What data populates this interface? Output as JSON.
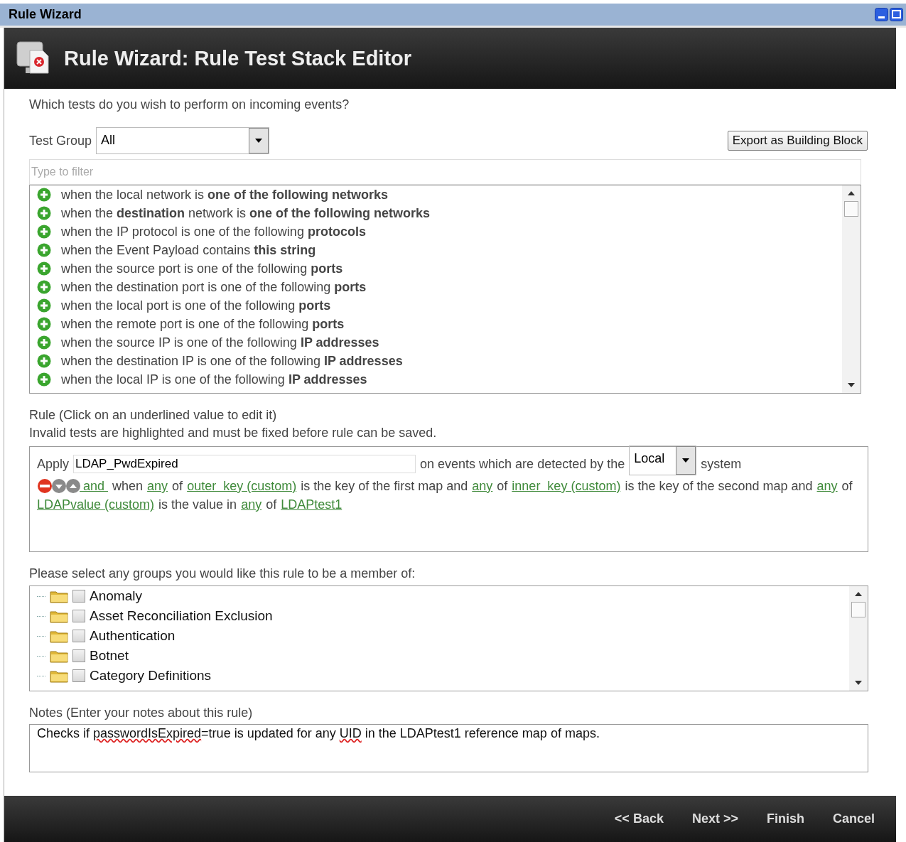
{
  "window": {
    "title": "Rule Wizard"
  },
  "header": {
    "title": "Rule Wizard: Rule Test Stack Editor"
  },
  "question": "Which tests do you wish to perform on incoming events?",
  "test_group": {
    "label": "Test Group",
    "value": "All"
  },
  "export_button": "Export as Building Block",
  "filter": {
    "placeholder": "Type to filter"
  },
  "tests": [
    "when the local network is **one of the following networks**",
    "when the **destination** network is **one of the following networks**",
    "when the IP protocol is one of the following **protocols**",
    "when the Event Payload contains **this string**",
    "when the source port is one of the following **ports**",
    "when the destination port is one of the following **ports**",
    "when the local port is one of the following **ports**",
    "when the remote port is one of the following **ports**",
    "when the source IP is one of the following **IP addresses**",
    "when the destination IP is one of the following **IP addresses**",
    "when the local IP is one of the following **IP addresses**"
  ],
  "rule_label": [
    "Rule (Click on an underlined value to edit it)",
    "Invalid tests are highlighted and must be fixed before rule can be saved."
  ],
  "rule": {
    "apply": "Apply",
    "name": "LDAP_PwdExpired",
    "events_text": "on events which are detected by the",
    "system_value": "Local",
    "system_text": "system",
    "parts": [
      {
        "kind": "link",
        "text": " and "
      },
      {
        "kind": "text",
        "text": "when"
      },
      {
        "kind": "link",
        "text": "any"
      },
      {
        "kind": "text",
        "text": "of"
      },
      {
        "kind": "link",
        "text": "outer  key (custom)"
      },
      {
        "kind": "text",
        "text": "is the key of the first map and"
      },
      {
        "kind": "link",
        "text": "any"
      },
      {
        "kind": "text",
        "text": "of"
      },
      {
        "kind": "link",
        "text": "inner  key (custom)"
      },
      {
        "kind": "text",
        "text": "is the key of the second map and"
      },
      {
        "kind": "link",
        "text": "any"
      },
      {
        "kind": "text",
        "text": "of"
      },
      {
        "kind": "link",
        "text": "LDAPvalue (custom)"
      },
      {
        "kind": "text",
        "text": "is the value in"
      },
      {
        "kind": "link",
        "text": "any"
      },
      {
        "kind": "text",
        "text": "of"
      },
      {
        "kind": "link",
        "text": "LDAPtest1"
      }
    ]
  },
  "groups_label": "Please select any groups you would like this rule to be a member of:",
  "groups": [
    {
      "label": "Anomaly",
      "checked": false
    },
    {
      "label": "Asset Reconciliation Exclusion",
      "checked": false
    },
    {
      "label": "Authentication",
      "checked": false
    },
    {
      "label": "Botnet",
      "checked": false
    },
    {
      "label": "Category Definitions",
      "checked": false
    }
  ],
  "notes_label": "Notes (Enter your notes about this rule)",
  "notes": [
    {
      "kind": "text",
      "text": "Checks if "
    },
    {
      "kind": "misspelled",
      "text": "passwordIsExpired"
    },
    {
      "kind": "text",
      "text": "=true is updated for any "
    },
    {
      "kind": "misspelled",
      "text": "UID"
    },
    {
      "kind": "text",
      "text": " in the LDAPtest1 reference map of maps."
    }
  ],
  "footer_buttons": [
    "<< Back",
    "Next >>",
    "Finish",
    "Cancel"
  ]
}
